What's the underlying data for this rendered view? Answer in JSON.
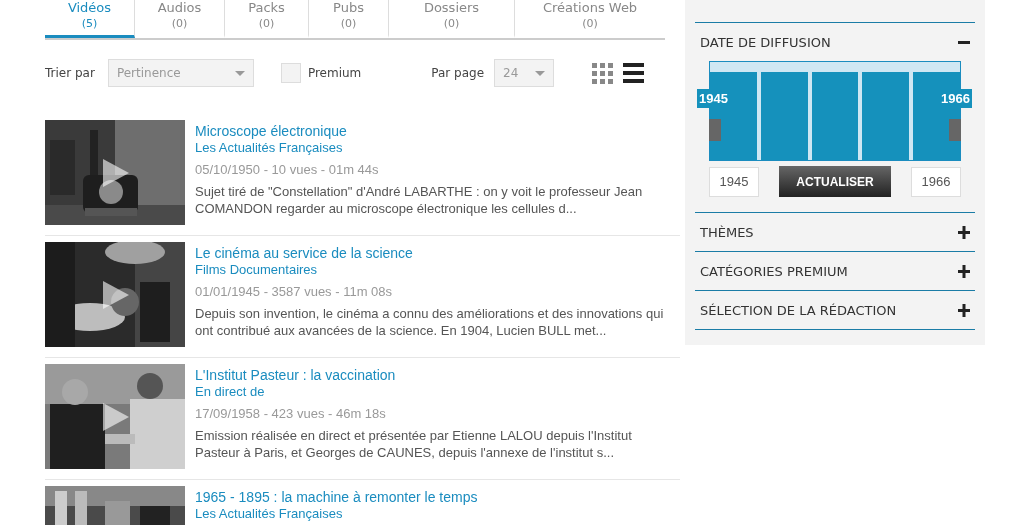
{
  "tabs": [
    {
      "label": "Vidéos",
      "count": "(5)",
      "selected": true
    },
    {
      "label": "Audios",
      "count": "(0)",
      "selected": false
    },
    {
      "label": "Packs",
      "count": "(0)",
      "selected": false
    },
    {
      "label": "Pubs",
      "count": "(0)",
      "selected": false
    },
    {
      "label": "Dossiers",
      "count": "(0)",
      "selected": false
    },
    {
      "label": "Créations Web",
      "count": "(0)",
      "selected": false
    }
  ],
  "toolbar": {
    "sort_label": "Trier par",
    "sort_value": "Pertinence",
    "premium": {
      "label": "Premium",
      "checked": false
    },
    "per_page_label": "Par page",
    "per_page_value": "24",
    "views": [
      {
        "kind": "grid",
        "selected": false
      },
      {
        "kind": "list",
        "selected": true
      }
    ]
  },
  "results": [
    {
      "title": "Microscope électronique",
      "source": "Les Actualités Françaises",
      "meta": "05/10/1950 - 10 vues - 01m 44s",
      "description": "Sujet tiré de \"Constellation\" d'André LABARTHE : on y voit le professeur Jean COMANDON regarder au microscope électronique les cellules d..."
    },
    {
      "title": "Le cinéma au service de la science",
      "source": "Films Documentaires",
      "meta": "01/01/1945 - 3587 vues - 11m 08s",
      "description": "Depuis son invention, le cinéma a connu des améliorations et des innovations qui ont contribué aux avancées de la science. En 1904, Lucien BULL met..."
    },
    {
      "title": "L'Institut Pasteur : la vaccination",
      "source": "En direct de",
      "meta": "17/09/1958 - 423 vues - 46m 18s",
      "description": "Emission réalisée en direct et présentée par Etienne LALOU depuis l'Institut Pasteur à Paris, et Georges de CAUNES, depuis l'annexe de l'institut s..."
    },
    {
      "title": "1965 - 1895 : la machine à remonter le temps",
      "source": "Les Actualités Françaises"
    }
  ],
  "filters": [
    {
      "kind": "date",
      "title": "DATE DE DIFFUSION",
      "expanded": true,
      "handles": [
        {
          "label": "1945",
          "level": 0
        },
        {
          "label": "1966",
          "level": 1
        }
      ],
      "min_value": "1945",
      "max_value": "1966",
      "button": "ACTUALISER"
    },
    {
      "kind": "section",
      "title": "THÈMES",
      "expanded": false
    },
    {
      "kind": "section",
      "title": "CATÉGORIES PREMIUM",
      "expanded": false
    },
    {
      "kind": "section",
      "title": "SÉLECTION DE LA RÉDACTION",
      "expanded": false
    }
  ]
}
